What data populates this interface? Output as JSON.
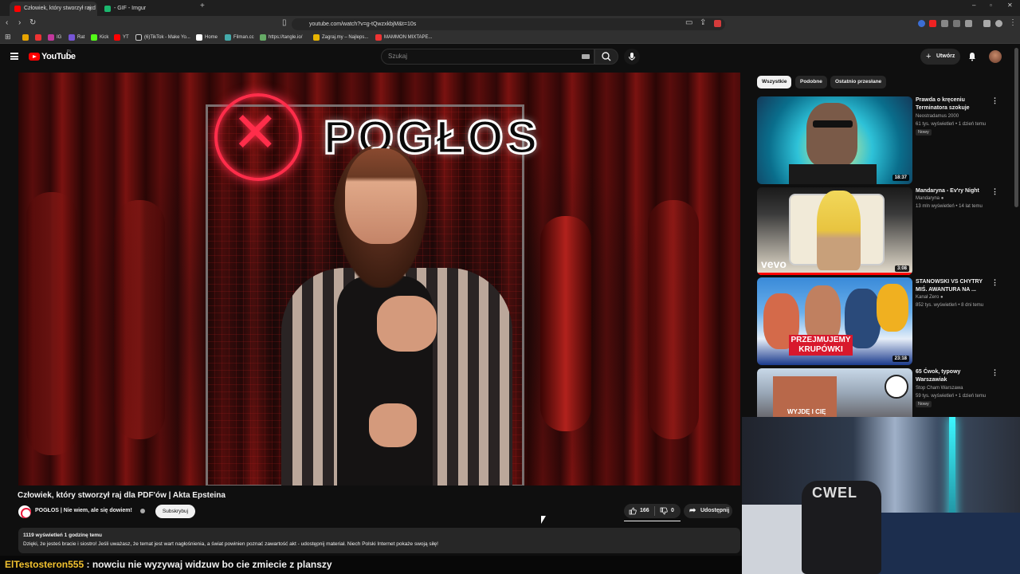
{
  "browser": {
    "tabs": [
      {
        "title": "Człowiek, który stworzył raj d",
        "active": true
      },
      {
        "title": "- GIF - Imgur",
        "active": false
      }
    ],
    "url": "youtube.com/watch?v=g-tQwzxkbjM&t=10s",
    "bookmarks": [
      "IG",
      "Rat",
      "Kick",
      "YT",
      "(6)TikTok - Make Yo...",
      "Home",
      "Filman.cc",
      "https://tangle.io/",
      "Zagraj.my – Najleps...",
      "MAMMON MIXTAPE..."
    ]
  },
  "header": {
    "logo": "YouTube",
    "country": "PL",
    "search_placeholder": "Szukaj",
    "create_label": "Utwórz"
  },
  "video": {
    "neon_text": "POGŁOS",
    "title": "Człowiek, który stworzył raj dla PDF'ów | Akta Epsteina",
    "channel": "POGŁOS | Nie wiem, ale się dowiem!",
    "subscribe_label": "Subskrybuj",
    "likes": "166",
    "dislikes": "0",
    "share_label": "Udostępnij",
    "stats": "1119 wyświetleń  1 godzinę temu",
    "description": "Dzięki, że jesteś bracie i siostro! Jeśli uważasz, że temat jest wart nagłośnienia, a świat powinien poznać zawartość akt - udostępnij materiał. Niech Polski Internet pokaże swoją siłę!"
  },
  "sidebar": {
    "chips": [
      "Wszystkie",
      "Podobne",
      "Ostatnio przesłane"
    ],
    "videos": [
      {
        "title": "Prawda o kręceniu Terminatora szokuje",
        "channel": "Neostradamus 2000",
        "meta": "61 tys. wyświetleń • 1 dzień temu",
        "badge": "Nowy",
        "duration": "18:37"
      },
      {
        "title": "Mandaryna - Ev'ry Night",
        "channel": "Mandaryna",
        "meta": "13 mln wyświetleń • 14 lat temu",
        "badge": "",
        "duration": "3:08",
        "overlay": "vevo"
      },
      {
        "title": "STANOWSKI VS CHYTRY MIŚ. AWANTURA NA ...",
        "channel": "Kanał Zero",
        "meta": "852 tys. wyświetleń • 8 dni temu",
        "badge": "",
        "duration": "23:18",
        "overlay": "PRZEJMUJEMY KRUPÓWKI"
      },
      {
        "title": "65 Ćwok, typowy Warszawiak",
        "channel": "Stop Cham Warszawa",
        "meta": "59 tys. wyświetleń • 1 dzień temu",
        "badge": "Nowy",
        "duration": "",
        "overlay": "WYJDĘ I CIĘ"
      }
    ]
  },
  "webcam": {
    "chair_text": "CWEL"
  },
  "chat": {
    "user": "ElTestosteron555",
    "message": " : nowciu nie wyzywaj widzuw bo cie zmiecie z planszy"
  }
}
